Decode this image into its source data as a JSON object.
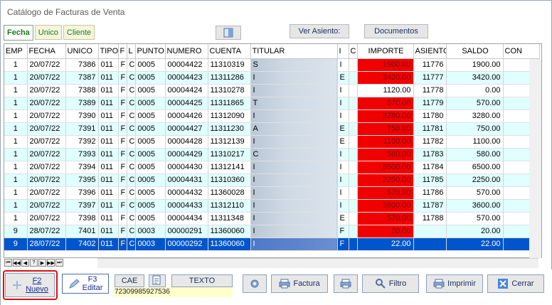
{
  "window": {
    "title": "Catálogo  de Facturas de Venta"
  },
  "tabs": [
    "Fecha",
    "Unico",
    "Cliente"
  ],
  "toolbar": {
    "ver_asiento": "Ver Asiento:",
    "documentos": "Documentos"
  },
  "columns": [
    "EMP",
    "FECHA",
    "UNICO",
    "TIPO",
    "F",
    "L",
    "PUNTO",
    "NUMERO",
    "CUENTA",
    "TITULAR",
    "I",
    "C",
    "IMPORTE",
    "ASIENTO",
    "SALDO",
    "CON"
  ],
  "rows": [
    [
      "1",
      "20/07/22",
      "7386",
      "011",
      "F",
      "C",
      "0005",
      "00004422",
      "11310319",
      "S",
      "I",
      "",
      "1900.00",
      "11776",
      "1900.00"
    ],
    [
      "1",
      "20/07/22",
      "7387",
      "011",
      "F",
      "C",
      "0005",
      "00004423",
      "11311286",
      "I",
      "E",
      "",
      "3420.00",
      "11777",
      "3420.00"
    ],
    [
      "1",
      "20/07/22",
      "7388",
      "011",
      "F",
      "C",
      "0005",
      "00004424",
      "11310278",
      "I",
      "I",
      "",
      "1120.00",
      "11778",
      "0.00"
    ],
    [
      "1",
      "20/07/22",
      "7389",
      "011",
      "F",
      "C",
      "0005",
      "00004425",
      "11311865",
      "T",
      "I",
      "",
      "570.00",
      "11779",
      "570.00"
    ],
    [
      "1",
      "20/07/22",
      "7390",
      "011",
      "F",
      "C",
      "0005",
      "00004426",
      "11312090",
      "I",
      "I",
      "",
      "3280.00",
      "11780",
      "3280.00"
    ],
    [
      "1",
      "20/07/22",
      "7391",
      "011",
      "F",
      "C",
      "0005",
      "00004427",
      "11311230",
      "A",
      "E",
      "",
      "750.00",
      "11781",
      "750.00"
    ],
    [
      "1",
      "20/07/22",
      "7392",
      "011",
      "F",
      "C",
      "0005",
      "00004428",
      "11312139",
      "I",
      "E",
      "",
      "1100.00",
      "11782",
      "1100.00"
    ],
    [
      "1",
      "20/07/22",
      "7393",
      "011",
      "F",
      "C",
      "0005",
      "00004429",
      "11310217",
      "C",
      "I",
      "",
      "580.00",
      "11783",
      "580.00"
    ],
    [
      "1",
      "20/07/22",
      "7394",
      "011",
      "F",
      "C",
      "0005",
      "00004430",
      "11312141",
      "I",
      "I",
      "",
      "6500.00",
      "11784",
      "6500.00"
    ],
    [
      "1",
      "20/07/22",
      "7395",
      "011",
      "F",
      "C",
      "0005",
      "00004431",
      "11310360",
      "I",
      "I",
      "",
      "2250.00",
      "11785",
      "2250.00"
    ],
    [
      "1",
      "20/07/22",
      "7396",
      "011",
      "F",
      "C",
      "0005",
      "00004432",
      "11360028",
      "I",
      "I",
      "",
      "570.00",
      "11786",
      "570.00"
    ],
    [
      "1",
      "20/07/22",
      "7397",
      "011",
      "F",
      "C",
      "0005",
      "00004433",
      "11312110",
      "I",
      "I",
      "",
      "3600.00",
      "11787",
      "3600.00"
    ],
    [
      "1",
      "20/07/22",
      "7398",
      "011",
      "F",
      "C",
      "0005",
      "00004434",
      "11311348",
      "I",
      "E",
      "",
      "570.00",
      "11788",
      "570.00"
    ],
    [
      "9",
      "28/07/22",
      "7401",
      "011",
      "F",
      "C",
      "0003",
      "00000291",
      "11360060",
      "I",
      "F",
      "",
      "20.00",
      "",
      "20.00"
    ],
    [
      "9",
      "28/07/22",
      "7402",
      "011",
      "F",
      "C",
      "0003",
      "00000292",
      "11360060",
      "I",
      "F",
      "",
      "22.00",
      "",
      "22.00"
    ]
  ],
  "nav_buttons": [
    "⏮",
    "◀◀",
    "◀",
    "?",
    "▶",
    "▶▶",
    "⏭"
  ],
  "bottom": {
    "nuevo": "F2\nNuevo",
    "editar": "F3\nEditar",
    "cae": "CAE",
    "texto": "TEXTO",
    "cae_value": "72309985927536",
    "factura": "Factura",
    "filtro": "Filtro",
    "imprimir": "Imprimir",
    "cerrar": "Cerrar"
  },
  "colors": {
    "importe_red": "#f10000",
    "selected_row": "#0055cc",
    "alt_row": "#e0ffff"
  }
}
